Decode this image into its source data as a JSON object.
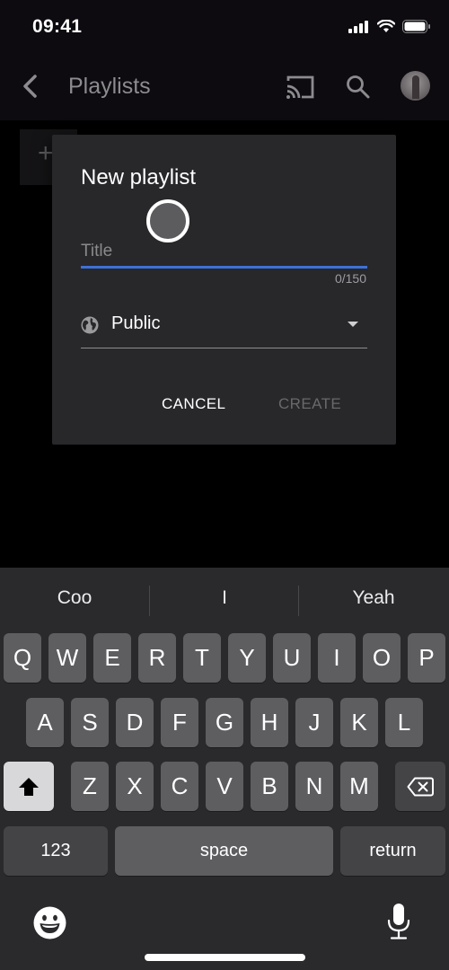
{
  "status_bar": {
    "time": "09:41"
  },
  "header": {
    "title": "Playlists",
    "back_icon": "chevron-left",
    "cast_icon": "cast",
    "search_icon": "search",
    "avatar": "user-avatar"
  },
  "background": {
    "add_icon": "+"
  },
  "dialog": {
    "title": "New playlist",
    "title_field": {
      "placeholder": "Title",
      "value": "",
      "char_count": "0/150"
    },
    "privacy": {
      "icon": "globe",
      "selected": "Public"
    },
    "buttons": {
      "cancel": "CANCEL",
      "create": "CREATE"
    },
    "accent_color": "#3e71d6"
  },
  "keyboard": {
    "suggestions": [
      "Coo",
      "I",
      "Yeah"
    ],
    "rows": [
      [
        "Q",
        "W",
        "E",
        "R",
        "T",
        "Y",
        "U",
        "I",
        "O",
        "P"
      ],
      [
        "A",
        "S",
        "D",
        "F",
        "G",
        "H",
        "J",
        "K",
        "L"
      ],
      [
        "Z",
        "X",
        "C",
        "V",
        "B",
        "N",
        "M"
      ]
    ],
    "numbers_label": "123",
    "space_label": "space",
    "return_label": "return"
  }
}
